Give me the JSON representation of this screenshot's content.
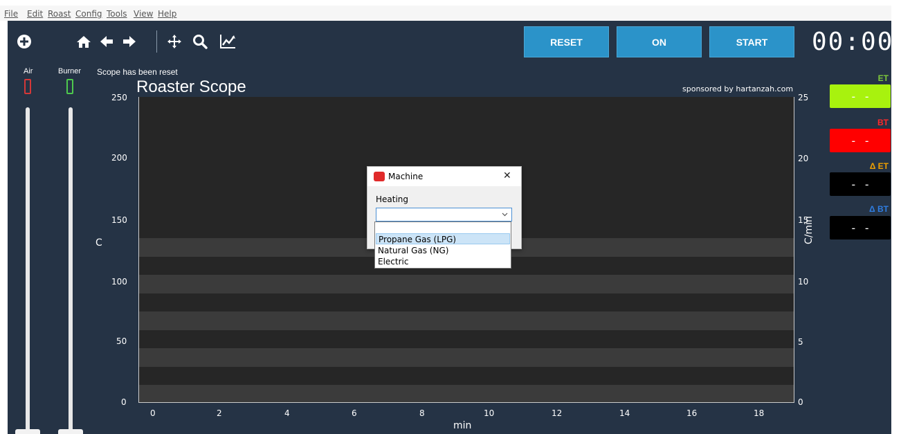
{
  "menu": [
    "File",
    "Edit",
    "Roast",
    "Config",
    "Tools",
    "View",
    "Help"
  ],
  "toolbar": {
    "icons": [
      "add-icon",
      "home-icon",
      "back-arrow-icon",
      "forward-arrow-icon",
      "pan-icon",
      "zoom-icon",
      "chart-icon"
    ],
    "reset_label": "RESET",
    "on_label": "ON",
    "start_label": "START",
    "timer": "00:00"
  },
  "sliders": {
    "air_label": "Air",
    "burner_label": "Burner",
    "air_color": "#d43838",
    "burner_color": "#4ec94e"
  },
  "status_message": "Scope has been reset",
  "plot": {
    "title": "Roaster Scope",
    "sponsor": "sponsored by hartanzah.com",
    "y_label": "C",
    "y2_label": "C/min",
    "x_label": "min",
    "y_ticks": [
      "250",
      "200",
      "150",
      "100",
      "50",
      "0"
    ],
    "y2_ticks": [
      "25",
      "20",
      "15",
      "10",
      "5",
      "0"
    ],
    "x_ticks": [
      "0",
      "2",
      "4",
      "6",
      "8",
      "10",
      "12",
      "14",
      "16",
      "18"
    ],
    "colors": {
      "background": "#262626",
      "band": "#3b3b3b"
    }
  },
  "readouts": [
    {
      "label": "ET",
      "value": "- -",
      "label_color": "#7ec93a",
      "bg": "#a8f20e"
    },
    {
      "label": "BT",
      "value": "- -",
      "label_color": "#ff2a2a",
      "bg": "#ff0000"
    },
    {
      "label": "Δ ET",
      "value": "- -",
      "label_color": "#f0a000",
      "bg": "#000000"
    },
    {
      "label": "Δ BT",
      "value": "- -",
      "label_color": "#2f7de1",
      "bg": "#000000"
    }
  ],
  "dialog": {
    "title": "Machine",
    "close": "✕",
    "field_label": "Heating",
    "selected": "",
    "options": [
      "Propane Gas (LPG)",
      "Natural Gas (NG)",
      "Electric"
    ],
    "highlighted_index": 0
  }
}
